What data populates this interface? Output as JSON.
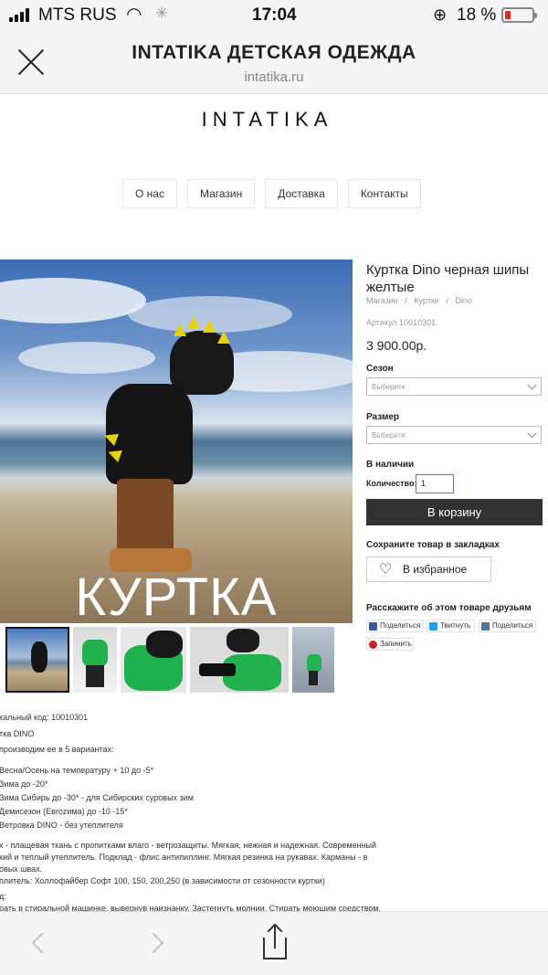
{
  "status_bar": {
    "carrier": "MTS RUS",
    "time": "17:04",
    "battery": "18 %"
  },
  "browser": {
    "title": "INTATIKA ДЕТСКАЯ ОДЕЖДА",
    "url": "intatika.ru"
  },
  "site": {
    "logo": "INTATIKA",
    "nav": [
      "О нас",
      "Магазин",
      "Доставка",
      "Контакты"
    ]
  },
  "product": {
    "photo_caption": "КУРТКА",
    "title": "Куртка Dino черная шипы желтые",
    "breadcrumbs": [
      "Магазин",
      "Куртки",
      "Dino"
    ],
    "breadcrumb_sep": "/",
    "sku": "Артикул 10010301",
    "price": "3 900.00р.",
    "season_label": "Сезон",
    "season_placeholder": "Выберите",
    "size_label": "Размер",
    "size_placeholder": "Выберите",
    "stock": "В наличии",
    "qty_label": "Количество:",
    "qty_value": "1",
    "cart_button": "В корзину",
    "bookmark_text": "Сохраните товар в закладках",
    "fav_button": "В избранное",
    "share_title": "Расскажите об этом товаре друзьям",
    "share": [
      {
        "label": "Поделиться",
        "icon": "facebook-icon",
        "color": "#3b5998"
      },
      {
        "label": "Твитнуть",
        "icon": "twitter-icon",
        "color": "#1da1f2"
      },
      {
        "label": "Поделиться",
        "icon": "vk-icon",
        "color": "#4c75a3"
      },
      {
        "label": "Запинить",
        "icon": "pinterest-icon",
        "color": "#cb2027"
      }
    ]
  },
  "description": [
    "кальный код: 10010301",
    "тка DINO",
    "производим ее в 5 вариантах:",
    "Весна/Осень на температуру + 10 до -5*",
    "Зима до -20*",
    "Зима Сибирь до -30* - для Сибирских суровых зим",
    "Демисезон (Евrozима) до -10 -15*",
    "Ветровка DINO - без утеплителя",
    "х - плащевая ткань с пропитками влаго - ветрозащиты. Мягкая, нежная и надежная. Современный",
    "кий и теплый утеплитель. Подклад - флис антипиллинг. Мягкая резинка на рукавах. Карманы - в",
    "овых швах.",
    "плитель: Холлофайбер Софт 100, 150, 200,250 (в зависимости от сезонности куртки)",
    "д:",
    "рать в стиральной машинке, вывернув наизнанку. Застегнуть молнии. Стирать моющим средством,"
  ],
  "colors": {
    "accent": "#333333",
    "link_gray": "#999999"
  }
}
